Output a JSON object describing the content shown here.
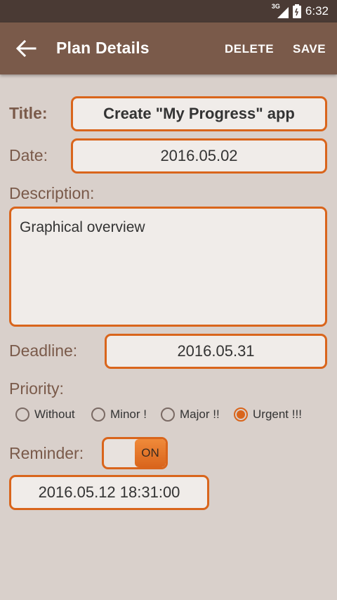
{
  "status_bar": {
    "network": "3G",
    "time": "6:32"
  },
  "app_bar": {
    "title": "Plan Details",
    "delete_label": "DELETE",
    "save_label": "SAVE"
  },
  "form": {
    "title_label": "Title:",
    "title_value": "Create \"My Progress\" app",
    "date_label": "Date:",
    "date_value": "2016.05.02",
    "description_label": "Description:",
    "description_value": "Graphical overview",
    "deadline_label": "Deadline:",
    "deadline_value": "2016.05.31",
    "priority_label": "Priority:",
    "priority_options": [
      {
        "label": "Without",
        "checked": false
      },
      {
        "label": "Minor !",
        "checked": false
      },
      {
        "label": "Major !!",
        "checked": false
      },
      {
        "label": "Urgent !!!",
        "checked": true
      }
    ],
    "reminder_label": "Reminder:",
    "reminder_toggle": "ON",
    "reminder_value": "2016.05.12 18:31:00"
  },
  "colors": {
    "accent": "#d9651c",
    "app_bar": "#7a5a4a",
    "status_bar": "#4a3a34",
    "background": "#d9d0cb"
  }
}
